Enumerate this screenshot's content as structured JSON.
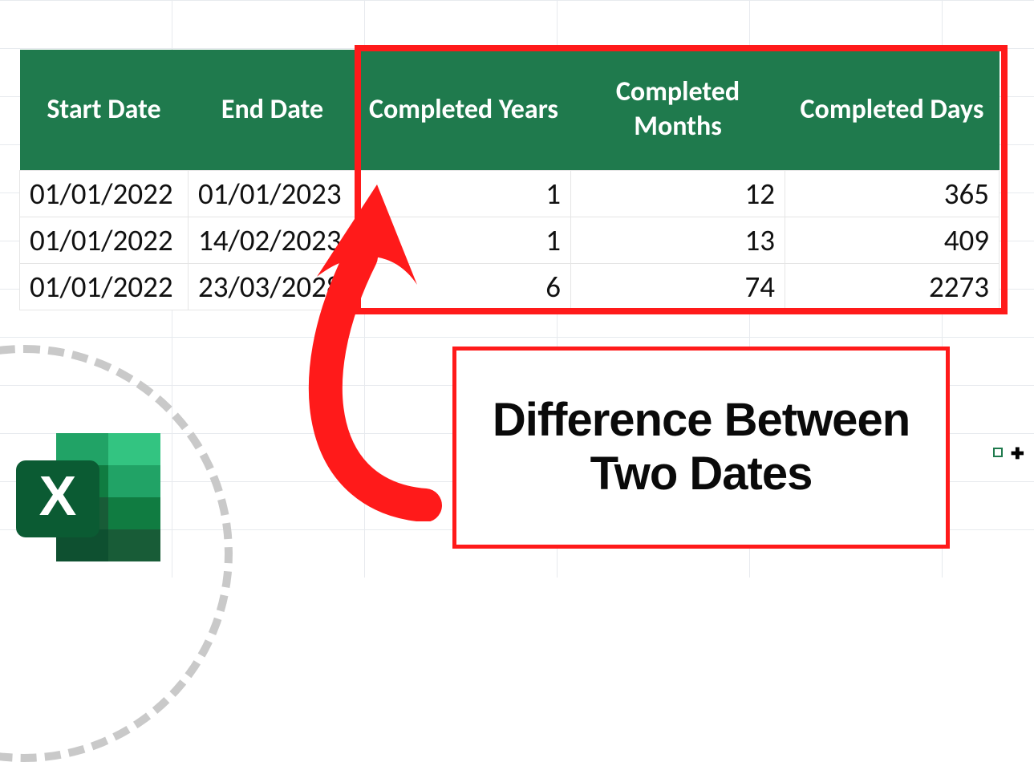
{
  "headers": {
    "start_date": "Start Date",
    "end_date": "End Date",
    "years": "Completed Years",
    "months": "Completed Months",
    "days": "Completed Days"
  },
  "rows": [
    {
      "start": "01/01/2022",
      "end": "01/01/2023",
      "years": "1",
      "months": "12",
      "days": "365"
    },
    {
      "start": "01/01/2022",
      "end": "14/02/2023",
      "years": "1",
      "months": "13",
      "days": "409"
    },
    {
      "start": "01/01/2022",
      "end": "23/03/2028",
      "years": "6",
      "months": "74",
      "days": "2273"
    }
  ],
  "callout": {
    "title_line1": "Difference Between",
    "title_line2": "Two Dates"
  },
  "icon": {
    "letter": "X"
  },
  "colors": {
    "header_bg": "#1f7a4d",
    "highlight": "#ff1a1a"
  },
  "chart_data": {
    "type": "table",
    "title": "Difference Between Two Dates",
    "columns": [
      "Start Date",
      "End Date",
      "Completed Years",
      "Completed Months",
      "Completed Days"
    ],
    "data": [
      [
        "01/01/2022",
        "01/01/2023",
        1,
        12,
        365
      ],
      [
        "01/01/2022",
        "14/02/2023",
        1,
        13,
        409
      ],
      [
        "01/01/2022",
        "23/03/2028",
        6,
        74,
        2273
      ]
    ]
  }
}
